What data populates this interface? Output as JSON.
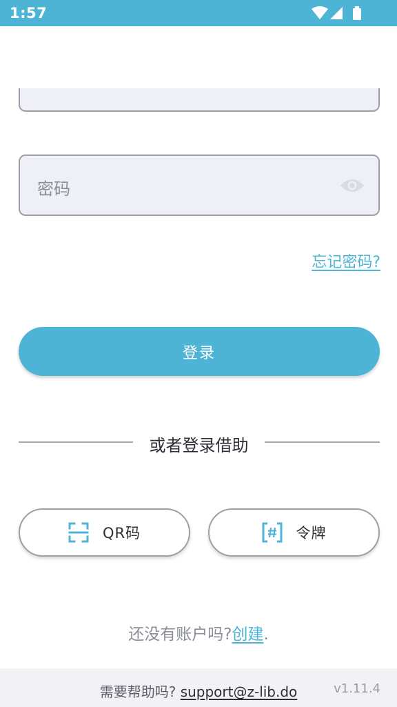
{
  "status_bar": {
    "time": "1:57",
    "background": "#4eb4d6",
    "icons": [
      "wifi-icon",
      "signal-icon",
      "battery-icon"
    ]
  },
  "form": {
    "password_placeholder": "密码",
    "forgot_password": "忘记密码?",
    "login_label": "登录",
    "divider_text": "或者登录借助",
    "qr_label": "QR码",
    "token_label": "令牌"
  },
  "signup": {
    "prefix": "还没有账户吗?",
    "link": "创建",
    "suffix": "."
  },
  "footer": {
    "help_prefix": "需要帮助吗?",
    "support_email": "support@z-lib.do",
    "version": "v1.11.4"
  },
  "colors": {
    "accent": "#4eb4d6",
    "input_bg": "#eff0f5",
    "border": "#9e9ea6"
  }
}
